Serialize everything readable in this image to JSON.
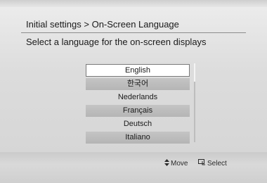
{
  "header": {
    "breadcrumb": "Initial settings > On-Screen Language",
    "subtitle": "Select a language for the on-screen displays"
  },
  "languages": {
    "items": [
      {
        "label": "English",
        "state": "selected"
      },
      {
        "label": "한국어",
        "state": "shaded"
      },
      {
        "label": "Nederlands",
        "state": "normal"
      },
      {
        "label": "Français",
        "state": "shaded"
      },
      {
        "label": "Deutsch",
        "state": "normal"
      },
      {
        "label": "Italiano",
        "state": "shaded"
      }
    ]
  },
  "footer": {
    "move_icon": "updown-arrow-icon",
    "move_label": "Move",
    "select_icon": "enter-icon",
    "select_label": "Select"
  }
}
